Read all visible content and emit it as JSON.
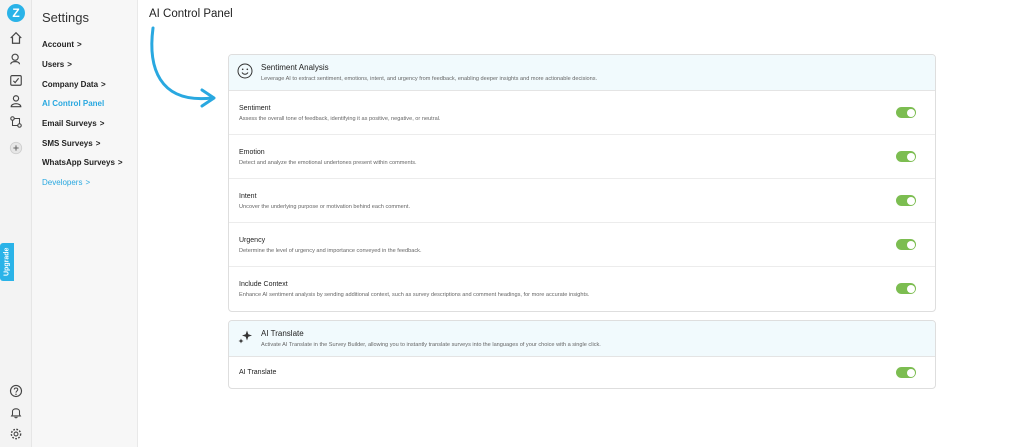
{
  "app": {
    "logo_letter": "Z",
    "upgrade_label": "Upgrade"
  },
  "rail": {
    "top_icons": [
      "home-icon",
      "search-users-icon",
      "surveys-icon",
      "user-icon",
      "integrations-icon",
      "plus-icon"
    ],
    "bottom_icons": [
      "help-icon",
      "notifications-icon",
      "gear-icon"
    ]
  },
  "sidebar": {
    "title": "Settings",
    "items": [
      {
        "label": "Account",
        "chevron": ">",
        "active": false
      },
      {
        "label": "Users",
        "chevron": ">",
        "active": false
      },
      {
        "label": "Company Data",
        "chevron": ">",
        "active": false
      },
      {
        "label": "AI Control Panel",
        "chevron": "",
        "active": true
      },
      {
        "label": "Email Surveys",
        "chevron": ">",
        "active": false
      },
      {
        "label": "SMS Surveys",
        "chevron": ">",
        "active": false
      },
      {
        "label": "WhatsApp Surveys",
        "chevron": ">",
        "active": false
      },
      {
        "label": "Developers",
        "chevron": ">",
        "active": false
      }
    ]
  },
  "page_title": "AI Control Panel",
  "sentiment_card": {
    "icon": "smile-icon",
    "title": "Sentiment Analysis",
    "description": "Leverage AI to extract sentiment, emotions, intent, and urgency from feedback, enabling deeper insights and more actionable decisions.",
    "rows": [
      {
        "title": "Sentiment",
        "description": "Assess the overall tone of feedback, identifying it as positive, negative, or neutral.",
        "enabled": true
      },
      {
        "title": "Emotion",
        "description": "Detect and analyze the emotional undertones present within comments.",
        "enabled": true
      },
      {
        "title": "Intent",
        "description": "Uncover the underlying purpose or motivation behind each comment.",
        "enabled": true
      },
      {
        "title": "Urgency",
        "description": "Determine the level of urgency and importance conveyed in the feedback.",
        "enabled": true
      },
      {
        "title": "Include Context",
        "description": "Enhance AI sentiment analysis by sending additional context, such as survey descriptions and comment headings, for more accurate insights.",
        "enabled": true
      }
    ]
  },
  "translate_card": {
    "icon": "sparkle-icon",
    "title": "AI Translate",
    "description": "Activate AI Translate in the Survey Builder, allowing you to instantly translate surveys into the languages of your choice with a single click.",
    "rows": [
      {
        "title": "AI Translate",
        "enabled": true
      }
    ]
  },
  "colors": {
    "accent": "#29a8e0",
    "toggle_on": "#7cbd51",
    "card_header_bg": "#f1fafd"
  }
}
